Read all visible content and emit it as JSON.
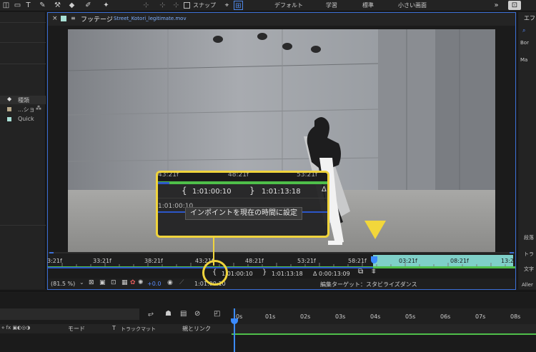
{
  "toolbar": {
    "snap_label": "スナップ",
    "workspaces": [
      "デフォルト",
      "学習",
      "標準",
      "小さい画面"
    ]
  },
  "left_panel": {
    "header": "種類",
    "items": [
      "...ショ",
      "Quick"
    ]
  },
  "footage_panel": {
    "tab_label": "フッテージ",
    "file_name": "Street_Kotori_legitimate.mov",
    "zoom": "(81.5 %)",
    "exposure": "+0.0",
    "current_time": "1:01:00:10",
    "edit_target": "編集ターゲット：スタビライズダンス",
    "ruler_ticks": [
      "3:21f",
      "33:21f",
      "38:21f",
      "43:21f",
      "48:21f",
      "53:21f",
      "58:21f",
      "03:21f",
      "08:21f",
      "13:2"
    ],
    "in_point": "1:01:00:10",
    "out_point": "1:01:13:18",
    "duration": "Δ 0:00:13:09"
  },
  "callout": {
    "ticks": [
      "43:21f",
      "48:21f",
      "53:21f"
    ],
    "in_point": "1:01:00:10",
    "out_point": "1:01:13:18",
    "time": "1:01:00:10",
    "tooltip": "インポイントを現在の時間に設定"
  },
  "right_panel": {
    "labels": [
      "エフ",
      "Bor",
      "Ma",
      "段落",
      "トラ",
      "文字",
      "Aller"
    ]
  },
  "timeline": {
    "ticks": [
      "0s",
      "01s",
      "02s",
      "03s",
      "04s",
      "05s",
      "06s",
      "07s",
      "08s"
    ],
    "col_mode": "モード",
    "col_t": "T",
    "col_trackmatte": "トラックマット",
    "col_parent": "親とリンク"
  },
  "colors": {
    "accent_blue": "#3b6fd6",
    "callout_yellow": "#f0d43c",
    "work_area_green": "#4fbf4a",
    "range_cyan": "#7fd0c8"
  }
}
